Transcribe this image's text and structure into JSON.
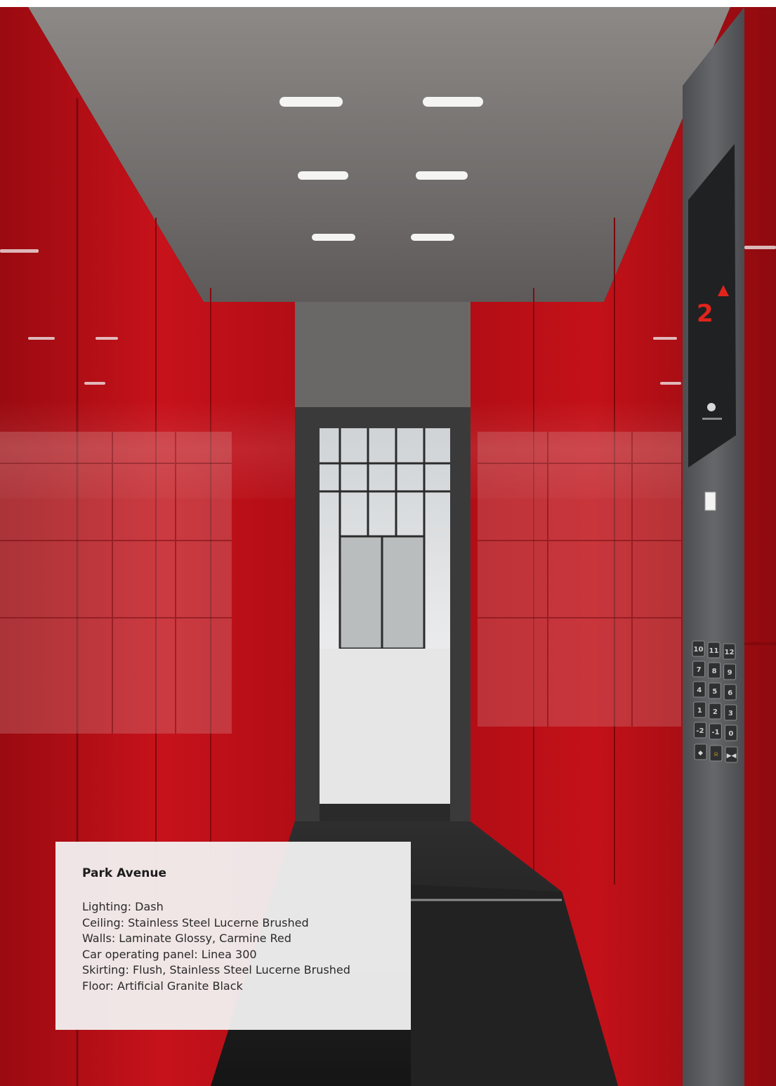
{
  "caption": {
    "title": "Park Avenue",
    "specs": [
      "Lighting: Dash",
      "Ceiling: Stainless Steel Lucerne Brushed",
      "Walls: Laminate Glossy, Carmine Red",
      "Car operating panel: Linea 300",
      "Skirting: Flush, Stainless Steel Lucerne Brushed",
      "Floor: Artificial Granite Black"
    ]
  },
  "operating_panel": {
    "floor_display": "2",
    "direction_icon": "up-arrow-icon",
    "keypad_rows": [
      [
        "10",
        "11",
        "12"
      ],
      [
        "7",
        "8",
        "9"
      ],
      [
        "4",
        "5",
        "6"
      ],
      [
        "1",
        "2",
        "3"
      ],
      [
        "-2",
        "-1",
        "0"
      ]
    ],
    "function_keys": [
      "door-open-icon",
      "alarm-bell-icon",
      "door-close-icon"
    ]
  },
  "colors": {
    "wall_red": "#c8101a",
    "ceiling_gray": "#6f6c6b",
    "panel_steel": "#56575a",
    "floor_black": "#1b1b1c",
    "display_red": "#e0241c"
  }
}
